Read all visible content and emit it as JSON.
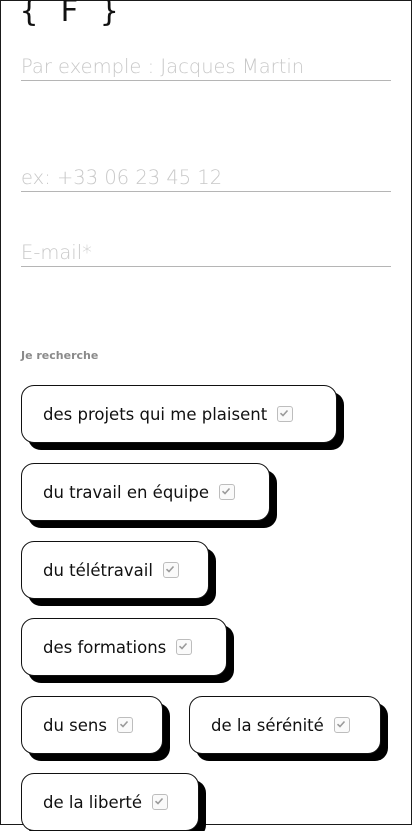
{
  "brand": {
    "logo": "{ F }"
  },
  "form": {
    "name_placeholder": "Par exemple : Jacques Martin",
    "phone_placeholder": "ex: +33 06 23 45 12",
    "email_placeholder": "E-mail*",
    "section_label": "Je recherche"
  },
  "options": [
    {
      "label": "des projets qui me plaisent",
      "checked": true
    },
    {
      "label": "du travail en équipe",
      "checked": true
    },
    {
      "label": "du télétravail",
      "checked": true
    },
    {
      "label": "des formations",
      "checked": true
    },
    {
      "label": "du sens",
      "checked": true
    },
    {
      "label": "de la sérénité",
      "checked": true
    },
    {
      "label": "de la liberté",
      "checked": true
    }
  ],
  "icons": {
    "option_check": "checkbox-checked-icon"
  }
}
